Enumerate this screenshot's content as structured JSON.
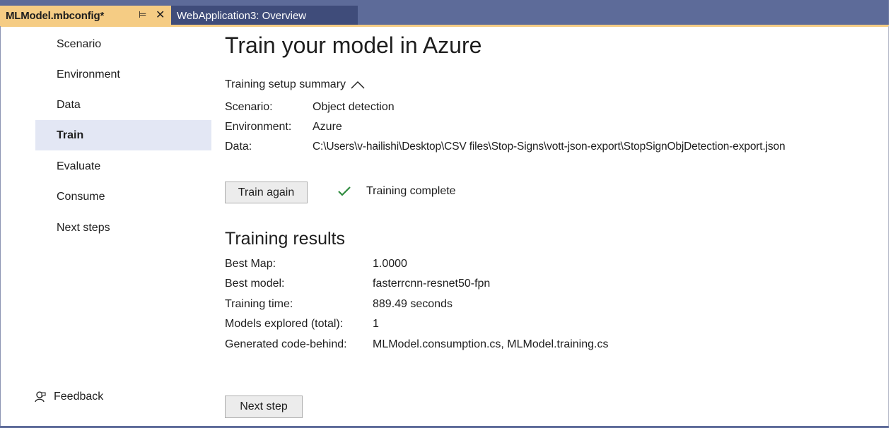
{
  "tabs": {
    "active": {
      "label": "MLModel.mbconfig*",
      "pin_glyph": "⊨",
      "close_glyph": "✕"
    },
    "inactive": {
      "label": "WebApplication3: Overview"
    }
  },
  "sidebar": {
    "items": [
      {
        "label": "Scenario"
      },
      {
        "label": "Environment"
      },
      {
        "label": "Data"
      },
      {
        "label": "Train",
        "selected": true
      },
      {
        "label": "Evaluate"
      },
      {
        "label": "Consume"
      },
      {
        "label": "Next steps"
      }
    ],
    "feedback_label": "Feedback"
  },
  "main": {
    "title": "Train your model in Azure",
    "summary": {
      "toggle_label": "Training setup summary",
      "rows": [
        {
          "key": "Scenario:",
          "value": "Object detection"
        },
        {
          "key": "Environment:",
          "value": "Azure"
        },
        {
          "key": "Data:",
          "value": "C:\\Users\\v-hailishi\\Desktop\\CSV files\\Stop-Signs\\vott-json-export\\StopSignObjDetection-export.json"
        }
      ]
    },
    "train_again_label": "Train again",
    "status_text": "Training complete",
    "results": {
      "title": "Training results",
      "rows": [
        {
          "key": "Best Map:",
          "value": "1.0000"
        },
        {
          "key": "Best model:",
          "value": "fasterrcnn-resnet50-fpn"
        },
        {
          "key": "Training time:",
          "value": "889.49 seconds"
        },
        {
          "key": "Models explored (total):",
          "value": "1"
        },
        {
          "key": "Generated code-behind:",
          "value": "MLModel.consumption.cs, MLModel.training.cs"
        }
      ]
    },
    "next_step_label": "Next step"
  },
  "colors": {
    "tab_active": "#f5cc84",
    "tab_strip": "#5d6b99",
    "tab_inactive": "#3f4c7a",
    "selected_nav": "#e3e7f4",
    "check_green": "#2e8b3e"
  }
}
